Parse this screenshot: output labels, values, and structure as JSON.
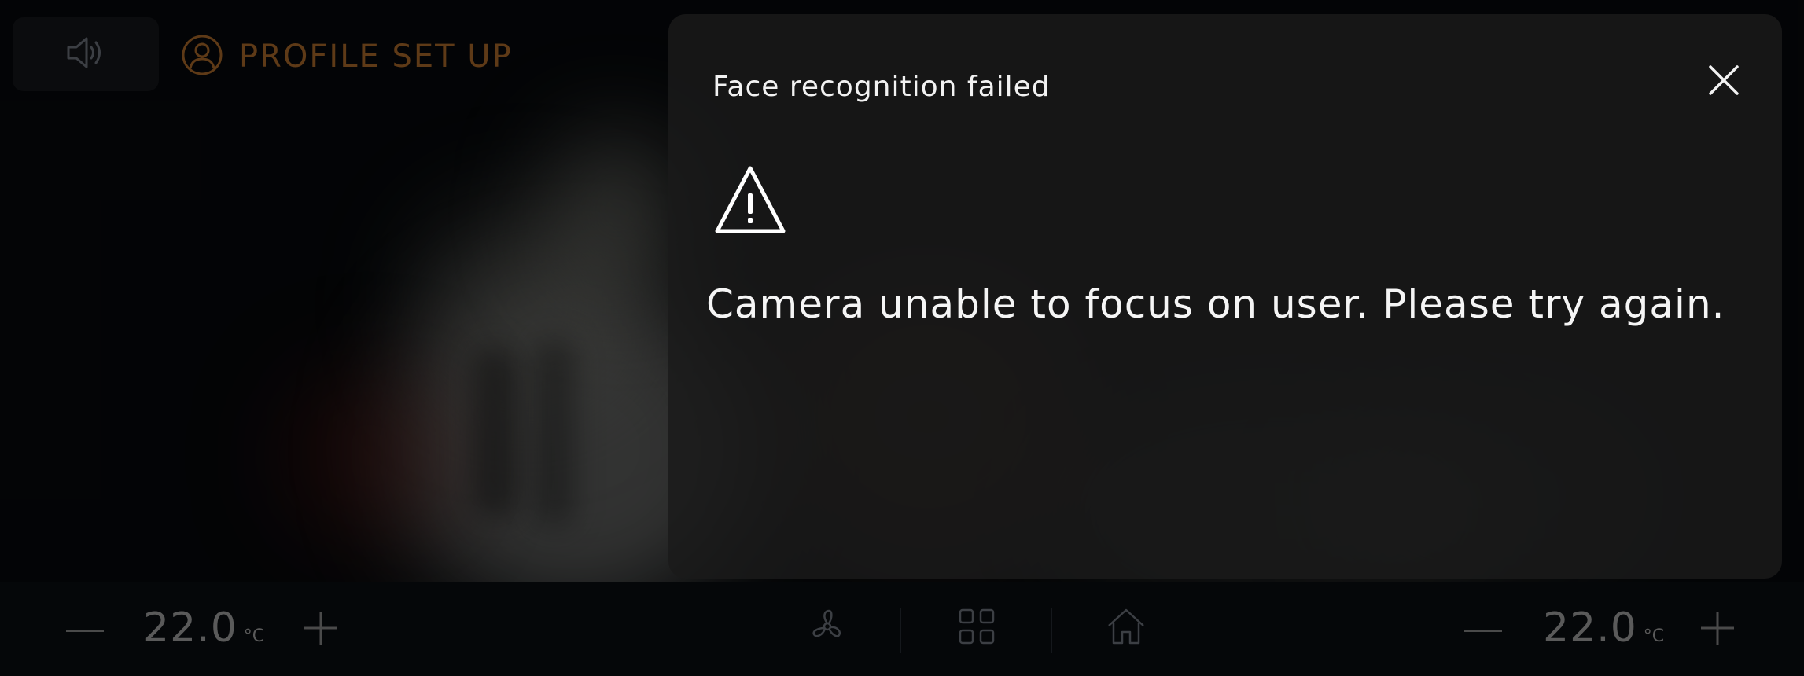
{
  "header": {
    "profile_title": "PROFILE SET UP",
    "volume_icon": "speaker-icon",
    "profile_icon": "user-circle-icon"
  },
  "modal": {
    "title": "Face recognition failed",
    "message": "Camera unable to focus on user. Please try again.",
    "warning_icon": "warning-triangle-icon",
    "close_icon": "close-icon"
  },
  "climate": {
    "left": {
      "temperature": "22.0",
      "unit": "°C",
      "minus_icon": "minus-icon",
      "plus_icon": "plus-icon"
    },
    "right": {
      "temperature": "22.0",
      "unit": "°C",
      "minus_icon": "minus-icon",
      "plus_icon": "plus-icon"
    }
  },
  "dock": {
    "fan_icon": "fan-icon",
    "apps_icon": "app-grid-icon",
    "home_icon": "home-icon"
  },
  "colors": {
    "accent": "#5e3a17",
    "modal_bg": "#1a1a1a",
    "text_primary": "#f2f2f2",
    "muted": "#5a5a5a"
  }
}
